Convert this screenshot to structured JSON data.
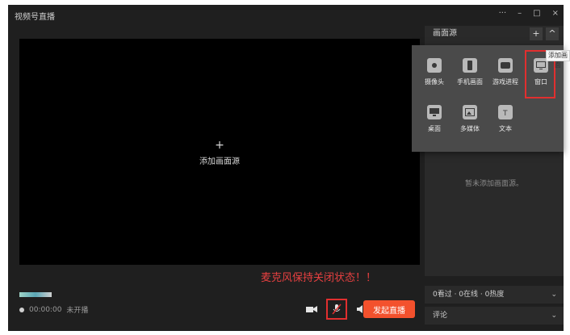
{
  "window": {
    "title": "视频号直播",
    "controls": [
      "···",
      "–",
      "□",
      "×"
    ]
  },
  "preview": {
    "add_source_plus": "+",
    "add_source_label": "添加画面源"
  },
  "warning_text": "麦克风保持关闭状态！！",
  "status": {
    "timer": "00:00:00",
    "live_state": "未开播"
  },
  "bottom_controls": {
    "icons": [
      "camera-icon",
      "mic-off-icon",
      "speaker-icon"
    ],
    "start_live_label": "发起直播"
  },
  "sources_panel": {
    "title": "画面源",
    "add_button": "+",
    "collapse_button": "^",
    "empty_text": "暂未添加画面源。"
  },
  "add_source_popup": {
    "tooltip": "添加画面",
    "items": [
      {
        "label": "摄像头",
        "icon": "webcam-icon"
      },
      {
        "label": "手机画面",
        "icon": "phone-icon"
      },
      {
        "label": "游戏进程",
        "icon": "game-icon"
      },
      {
        "label": "窗口",
        "icon": "window-icon"
      },
      {
        "label": "桌面",
        "icon": "desktop-icon"
      },
      {
        "label": "多媒体",
        "icon": "media-icon"
      },
      {
        "label": "文本",
        "icon": "text-icon"
      }
    ]
  },
  "stats_panel": {
    "text": "0看过 · 0在线 · 0热度",
    "chevron": "⌄"
  },
  "comments_panel": {
    "title": "评论",
    "chevron": "⌄"
  },
  "colors": {
    "app_bg": "#1f1f1f",
    "panel_bg": "#2a2a2a",
    "popup_bg": "#4a4a4a",
    "accent_red": "#e12f2f",
    "live_button": "#f3512d"
  }
}
